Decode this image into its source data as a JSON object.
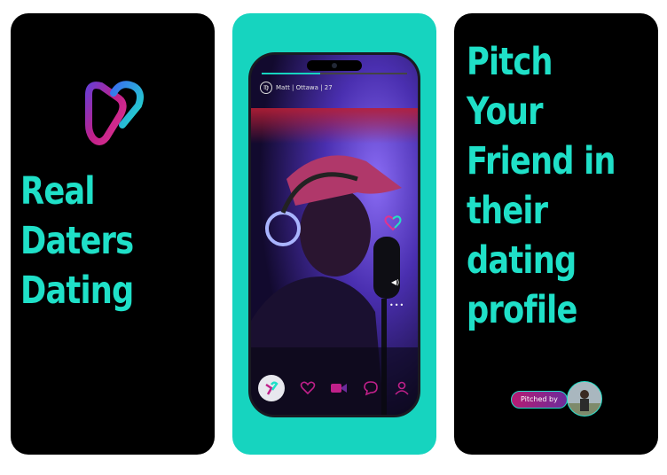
{
  "screens": [
    {
      "id": "intro",
      "headline_lines": [
        "Real",
        "Daters",
        "Dating"
      ],
      "logo_icon": "heart-chevron-logo-icon"
    },
    {
      "id": "profile-preview",
      "profile": {
        "zodiac_glyph": "♍",
        "header": "Matt | Ottawa | 27"
      },
      "story_progress": 0.4,
      "nav_icons": [
        "app-logo-icon",
        "heart-icon",
        "video-camera-icon",
        "chat-bubble-icon",
        "profile-icon"
      ]
    },
    {
      "id": "pitch",
      "headline_lines": [
        "Pitch",
        "Your",
        "Friend in",
        "their",
        "dating",
        "profile"
      ],
      "pitched_by_label": "Pitched by"
    }
  ],
  "colors": {
    "accent_teal": "#1fe0c8",
    "card_bg_teal": "#16d4bf",
    "brand_pink": "#e0338f",
    "brand_purple": "#6c2c9b",
    "card_bg_dark": "#000000"
  }
}
